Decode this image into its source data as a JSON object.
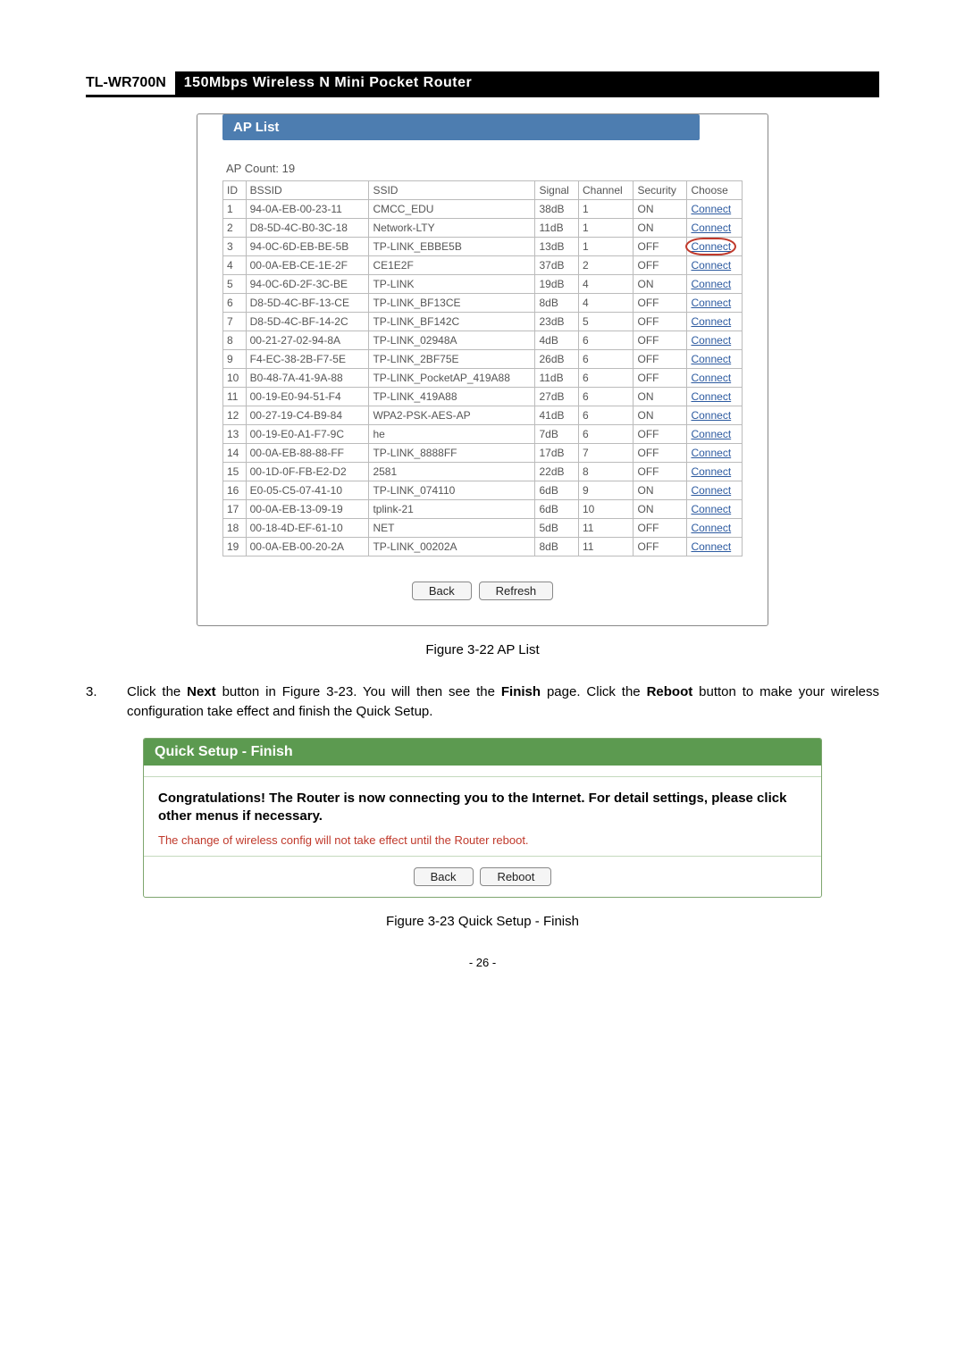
{
  "header": {
    "model": "TL-WR700N",
    "desc": "150Mbps Wireless N Mini Pocket Router"
  },
  "ap_panel": {
    "title": "AP List",
    "count_label": "AP Count:   19",
    "columns": {
      "id": "ID",
      "bssid": "BSSID",
      "ssid": "SSID",
      "signal": "Signal",
      "channel": "Channel",
      "security": "Security",
      "choose": "Choose"
    },
    "connect_label": "Connect",
    "highlight_row_index": 2,
    "rows": [
      {
        "id": "1",
        "bssid": "94-0A-EB-00-23-11",
        "ssid": "CMCC_EDU",
        "signal": "38dB",
        "channel": "1",
        "security": "ON"
      },
      {
        "id": "2",
        "bssid": "D8-5D-4C-B0-3C-18",
        "ssid": "Network-LTY",
        "signal": "11dB",
        "channel": "1",
        "security": "ON"
      },
      {
        "id": "3",
        "bssid": "94-0C-6D-EB-BE-5B",
        "ssid": "TP-LINK_EBBE5B",
        "signal": "13dB",
        "channel": "1",
        "security": "OFF"
      },
      {
        "id": "4",
        "bssid": "00-0A-EB-CE-1E-2F",
        "ssid": "CE1E2F",
        "signal": "37dB",
        "channel": "2",
        "security": "OFF"
      },
      {
        "id": "5",
        "bssid": "94-0C-6D-2F-3C-BE",
        "ssid": "TP-LINK",
        "signal": "19dB",
        "channel": "4",
        "security": "ON"
      },
      {
        "id": "6",
        "bssid": "D8-5D-4C-BF-13-CE",
        "ssid": "TP-LINK_BF13CE",
        "signal": "8dB",
        "channel": "4",
        "security": "OFF"
      },
      {
        "id": "7",
        "bssid": "D8-5D-4C-BF-14-2C",
        "ssid": "TP-LINK_BF142C",
        "signal": "23dB",
        "channel": "5",
        "security": "OFF"
      },
      {
        "id": "8",
        "bssid": "00-21-27-02-94-8A",
        "ssid": "TP-LINK_02948A",
        "signal": "4dB",
        "channel": "6",
        "security": "OFF"
      },
      {
        "id": "9",
        "bssid": "F4-EC-38-2B-F7-5E",
        "ssid": "TP-LINK_2BF75E",
        "signal": "26dB",
        "channel": "6",
        "security": "OFF"
      },
      {
        "id": "10",
        "bssid": "B0-48-7A-41-9A-88",
        "ssid": "TP-LINK_PocketAP_419A88",
        "signal": "11dB",
        "channel": "6",
        "security": "OFF"
      },
      {
        "id": "11",
        "bssid": "00-19-E0-94-51-F4",
        "ssid": "TP-LINK_419A88",
        "signal": "27dB",
        "channel": "6",
        "security": "ON"
      },
      {
        "id": "12",
        "bssid": "00-27-19-C4-B9-84",
        "ssid": "WPA2-PSK-AES-AP",
        "signal": "41dB",
        "channel": "6",
        "security": "ON"
      },
      {
        "id": "13",
        "bssid": "00-19-E0-A1-F7-9C",
        "ssid": "he",
        "signal": "7dB",
        "channel": "6",
        "security": "OFF"
      },
      {
        "id": "14",
        "bssid": "00-0A-EB-88-88-FF",
        "ssid": "TP-LINK_8888FF",
        "signal": "17dB",
        "channel": "7",
        "security": "OFF"
      },
      {
        "id": "15",
        "bssid": "00-1D-0F-FB-E2-D2",
        "ssid": "2581",
        "signal": "22dB",
        "channel": "8",
        "security": "OFF"
      },
      {
        "id": "16",
        "bssid": "E0-05-C5-07-41-10",
        "ssid": "TP-LINK_074110",
        "signal": "6dB",
        "channel": "9",
        "security": "ON"
      },
      {
        "id": "17",
        "bssid": "00-0A-EB-13-09-19",
        "ssid": "tplink-21",
        "signal": "6dB",
        "channel": "10",
        "security": "ON"
      },
      {
        "id": "18",
        "bssid": "00-18-4D-EF-61-10",
        "ssid": "NET",
        "signal": "5dB",
        "channel": "11",
        "security": "OFF"
      },
      {
        "id": "19",
        "bssid": "00-0A-EB-00-20-2A",
        "ssid": "TP-LINK_00202A",
        "signal": "8dB",
        "channel": "11",
        "security": "OFF"
      }
    ],
    "buttons": {
      "back": "Back",
      "refresh": "Refresh"
    }
  },
  "caption1": "Figure 3-22 AP List",
  "step3": {
    "num": "3.",
    "t0": "Click the ",
    "b1": "Next",
    "t1": " button in Figure 3-23. You will then see the ",
    "b2": "Finish",
    "t2": " page. Click the ",
    "b3": "Reboot",
    "t3": " button to make your wireless configuration take effect and finish the Quick Setup."
  },
  "qs": {
    "title": "Quick Setup - Finish",
    "line1": "Congratulations! The Router is now connecting you to the Internet. For detail settings, please click other menus if necessary.",
    "warn": "The change of wireless config will not take effect until the Router reboot.",
    "back": "Back",
    "reboot": "Reboot"
  },
  "caption2": "Figure 3-23 Quick Setup - Finish",
  "pagenum": "- 26 -"
}
